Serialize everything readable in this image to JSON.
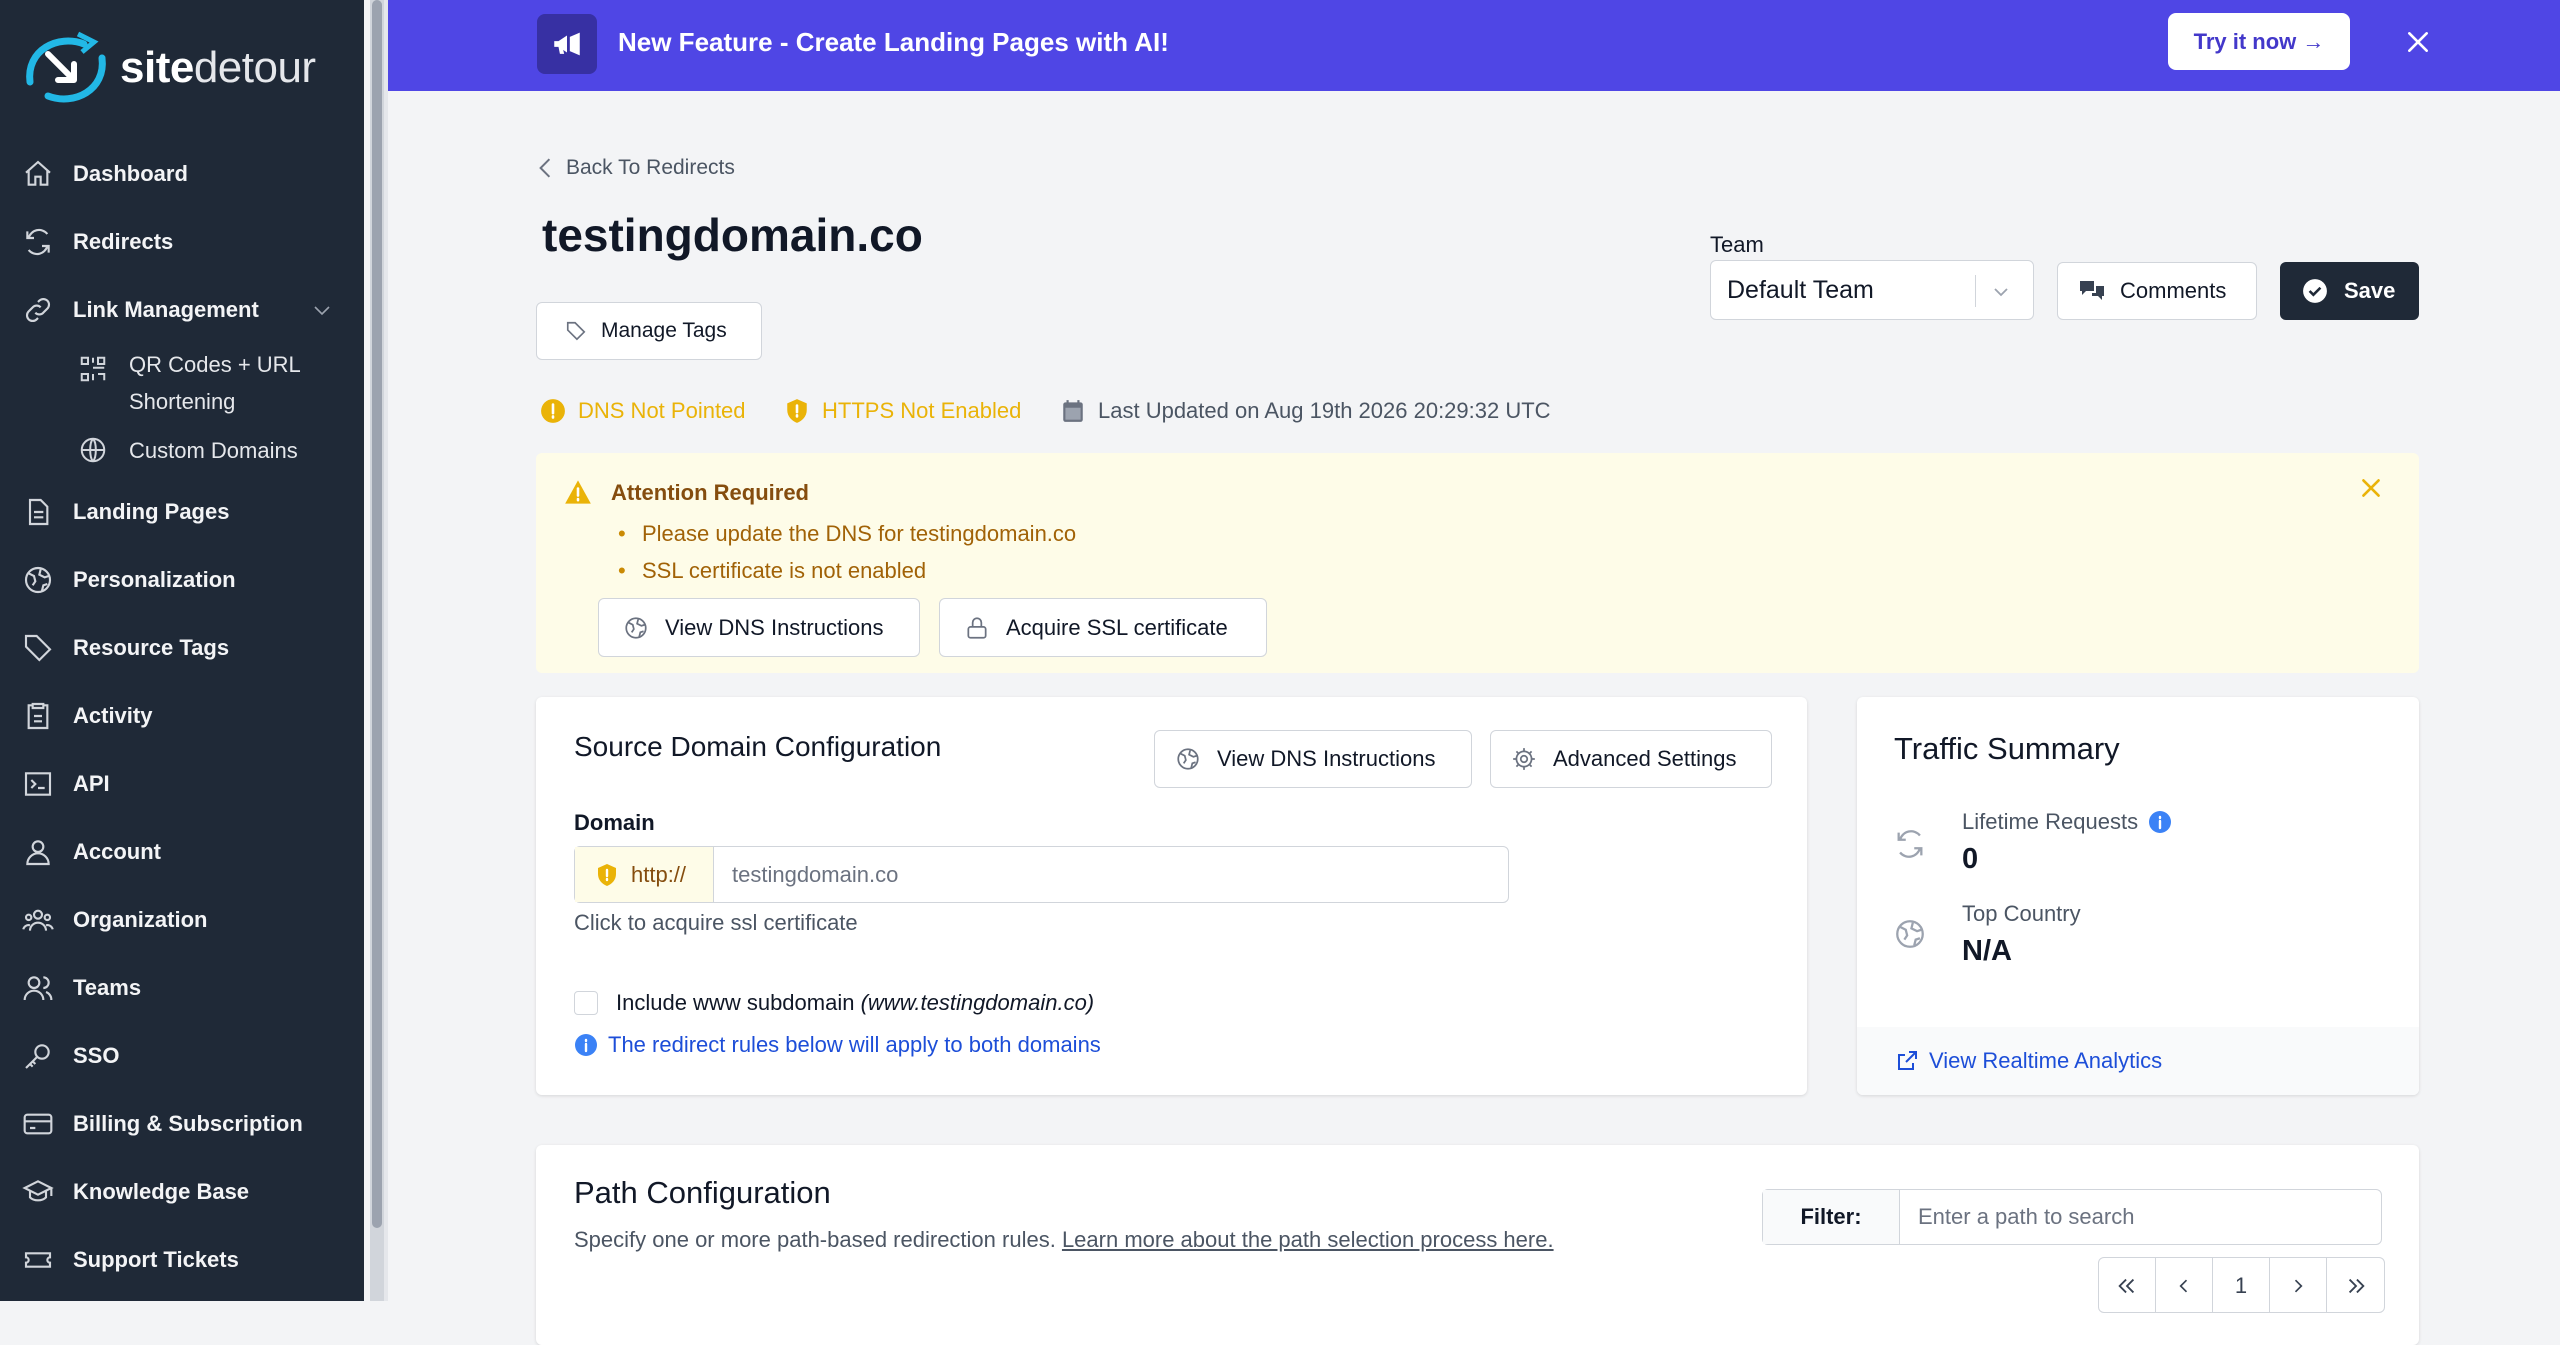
{
  "app": {
    "logo_bold": "site",
    "logo_rest": "detour"
  },
  "sidebar": {
    "items": [
      {
        "label": "Dashboard",
        "icon": "home-icon"
      },
      {
        "label": "Redirects",
        "icon": "refresh-icon"
      },
      {
        "label": "Link Management",
        "icon": "link-icon"
      },
      {
        "label": "QR Codes + URL",
        "label2": "Shortening",
        "icon": "qr-icon"
      },
      {
        "label": "Custom Domains",
        "icon": "globe-icon"
      },
      {
        "label": "Landing Pages",
        "icon": "document-icon"
      },
      {
        "label": "Personalization",
        "icon": "globe-alt-icon"
      },
      {
        "label": "Resource Tags",
        "icon": "tag-icon"
      },
      {
        "label": "Activity",
        "icon": "clipboard-icon"
      },
      {
        "label": "API",
        "icon": "terminal-icon"
      },
      {
        "label": "Account",
        "icon": "user-icon"
      },
      {
        "label": "Organization",
        "icon": "user-group-icon"
      },
      {
        "label": "Teams",
        "icon": "users-icon"
      },
      {
        "label": "SSO",
        "icon": "key-icon"
      },
      {
        "label": "Billing & Subscription",
        "icon": "credit-card-icon"
      },
      {
        "label": "Knowledge Base",
        "icon": "academic-cap-icon"
      },
      {
        "label": "Support Tickets",
        "icon": "ticket-icon"
      }
    ]
  },
  "banner": {
    "text": "New Feature - Create Landing Pages with AI!",
    "cta": "Try it now →"
  },
  "header": {
    "back_label": "Back To Redirects",
    "title": "testingdomain.co",
    "manage_tags": "Manage Tags",
    "team_label": "Team",
    "team_value": "Default Team",
    "comments": "Comments",
    "save": "Save"
  },
  "status": {
    "dns": "DNS Not Pointed",
    "https": "HTTPS Not Enabled",
    "updated": "Last Updated on Aug 19th 2026 20:29:32 UTC"
  },
  "alert": {
    "title": "Attention Required",
    "items": [
      "Please update the DNS for testingdomain.co",
      "SSL certificate is not enabled"
    ],
    "btn_dns": "View DNS Instructions",
    "btn_ssl": "Acquire SSL certificate"
  },
  "source": {
    "title": "Source Domain Configuration",
    "btn_dns": "View DNS Instructions",
    "btn_adv": "Advanced Settings",
    "domain_label": "Domain",
    "protocol": "http://",
    "domain_placeholder": "testingdomain.co",
    "hint": "Click to acquire ssl certificate",
    "www_label": "Include www subdomain",
    "www_italic": "(www.testingdomain.co)",
    "info": "The redirect rules below will apply to both domains"
  },
  "traffic": {
    "title": "Traffic Summary",
    "lifetime_label": "Lifetime Requests",
    "lifetime_value": "0",
    "country_label": "Top Country",
    "country_value": "N/A",
    "realtime": "View Realtime Analytics"
  },
  "path": {
    "title": "Path Configuration",
    "desc": "Specify one or more path-based redirection rules.",
    "link": "Learn more about the path selection process here.",
    "filter_label": "Filter:",
    "filter_placeholder": "Enter a path to search",
    "page": "1"
  },
  "colors": {
    "sidebar": "#1f2937",
    "banner": "#4f46e5",
    "warning": "#eab308",
    "alert_bg": "#fefce8",
    "link": "#1d4ed8"
  }
}
